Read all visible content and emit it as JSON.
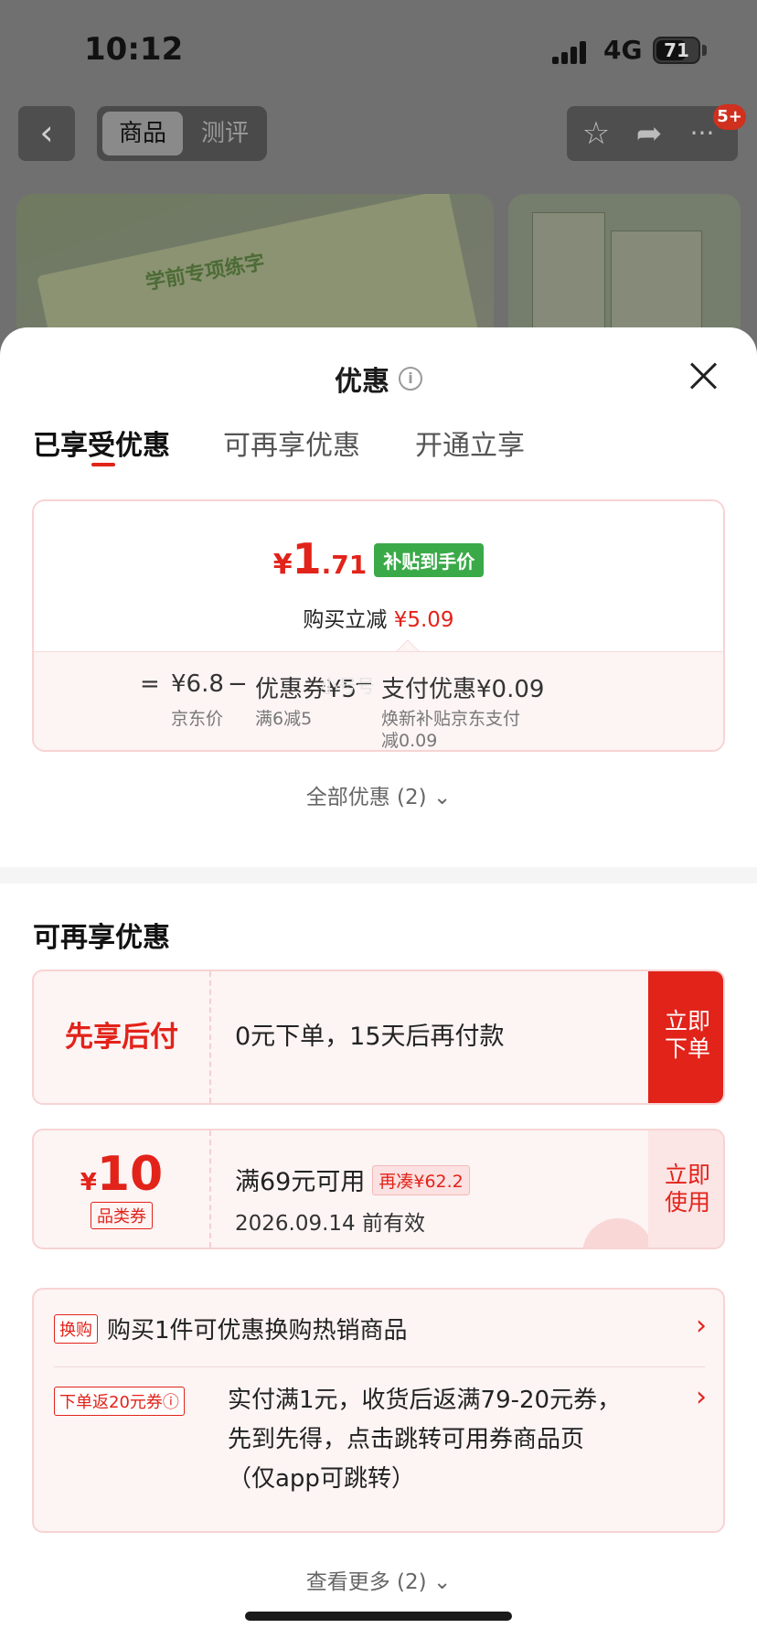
{
  "status": {
    "time": "10:12",
    "network": "4G",
    "battery": "71"
  },
  "top_nav": {
    "tab_goods": "商品",
    "tab_review": "测评",
    "cart_badge": "5+"
  },
  "product_image": {
    "title": "学前专项练字"
  },
  "modal": {
    "title": "优惠",
    "tabs": [
      "已享受优惠",
      "可再享优惠",
      "开通立享"
    ],
    "price_card": {
      "yen": "¥",
      "price_int": "1",
      "price_dec": ".71",
      "price_tag": "补贴到手价",
      "reduce_label": "购买立减",
      "reduce_amount": "¥5.09",
      "eq": "=",
      "jd_price": "¥6.8",
      "jd_label": "京东价",
      "minus": "−",
      "coupon": "优惠券¥5",
      "coupon_desc": "满6减5",
      "pay": "支付优惠¥0.09",
      "pay_desc_1": "焕新补贴京东支付",
      "pay_desc_2": "减0.09"
    },
    "watermark": "小号号",
    "all_discounts": "全部优惠 (2) ⌄",
    "section_title": "可再享优惠",
    "offer_bnpl": {
      "left": "先享后付",
      "desc": "0元下单，15天后再付款",
      "btn_1": "立即",
      "btn_2": "下单"
    },
    "offer_coupon": {
      "yen": "¥",
      "amount": "10",
      "category": "品类券",
      "condition": "满69元可用",
      "more_needed": "再凑¥62.2",
      "expiry": "2026.09.14 前有效",
      "btn_1": "立即",
      "btn_2": "使用"
    },
    "offer_misc": {
      "tag1": "换购",
      "text1": "购买1件可优惠换购热销商品",
      "tag2": "下单返20元券ⓘ",
      "text2": "实付满1元，收货后返满79-20元券，先到先得，点击跳转可用券商品页（仅app可跳转）"
    },
    "see_more": "查看更多 (2) ⌄"
  }
}
